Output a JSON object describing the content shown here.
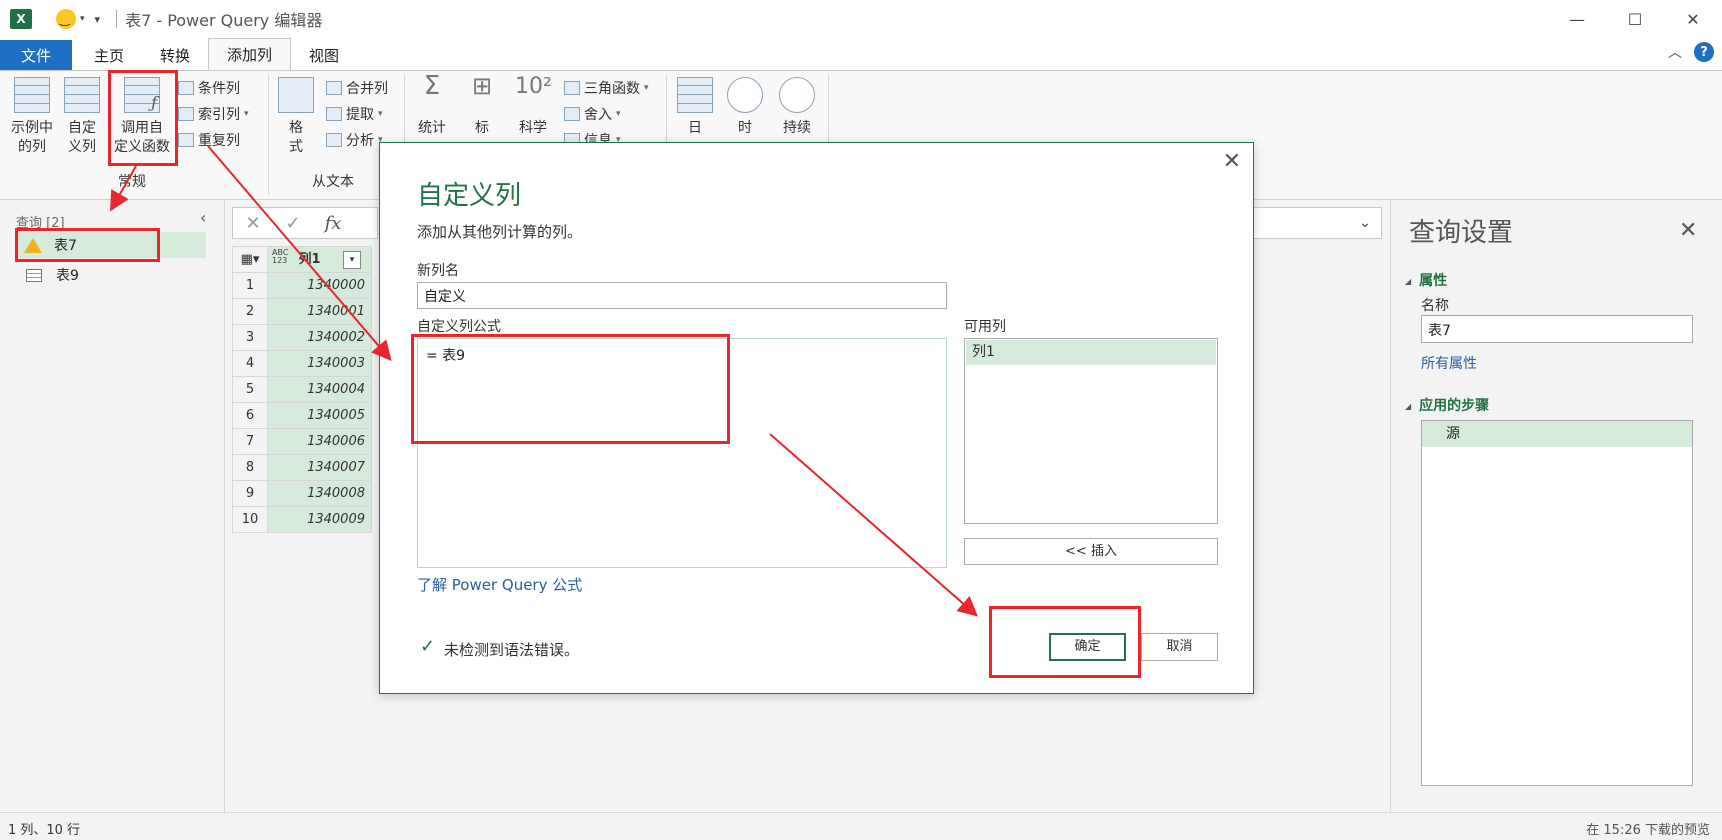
{
  "window": {
    "app_logo": "X",
    "title": "表7 - Power Query 编辑器",
    "controls": [
      "—",
      "☐",
      "✕"
    ]
  },
  "tabs": [
    {
      "label": "文件"
    },
    {
      "label": "主页"
    },
    {
      "label": "转换"
    },
    {
      "label": "添加列"
    },
    {
      "label": "视图"
    }
  ],
  "help_label": "?",
  "ribbon": {
    "example_col": "示例中\n的列",
    "custom_col": "自定\n义列",
    "invoke_fn": "调用自\n定义函数",
    "conditional_col": "条件列",
    "index_col": "索引列",
    "duplicate_col": "重复列",
    "group_general": "常规",
    "format": "格\n式",
    "merge_cols": "合并列",
    "extract": "提取",
    "parse": "分析",
    "group_from_text": "从文本",
    "statistics": "统计",
    "standard": "标",
    "scientific": "科学",
    "trig": "三角函数",
    "rounding": "舍入",
    "info": "信息",
    "date": "日",
    "time": "时",
    "duration": "持续"
  },
  "queries": {
    "header": "查询 [2]",
    "items": [
      "表7",
      "表9"
    ]
  },
  "formula_bar": {
    "cancel": "✕",
    "confirm": "✓",
    "fx": "fx",
    "expand": "⌄"
  },
  "grid": {
    "column_type": "ABC\n123",
    "column_name": "列1",
    "rows": [
      {
        "n": "1",
        "v": "1340000"
      },
      {
        "n": "2",
        "v": "1340001"
      },
      {
        "n": "3",
        "v": "1340002"
      },
      {
        "n": "4",
        "v": "1340003"
      },
      {
        "n": "5",
        "v": "1340004"
      },
      {
        "n": "6",
        "v": "1340005"
      },
      {
        "n": "7",
        "v": "1340006"
      },
      {
        "n": "8",
        "v": "1340007"
      },
      {
        "n": "9",
        "v": "1340008"
      },
      {
        "n": "10",
        "v": "1340009"
      }
    ]
  },
  "settings": {
    "title": "查询设置",
    "properties": "属性",
    "name_label": "名称",
    "name_value": "表7",
    "all_properties": "所有属性",
    "applied_steps": "应用的步骤",
    "steps": [
      "源"
    ]
  },
  "dialog": {
    "title": "自定义列",
    "subtitle": "添加从其他列计算的列。",
    "new_col_label": "新列名",
    "new_col_value": "自定义",
    "formula_label": "自定义列公式",
    "formula_value": "= 表9",
    "available_label": "可用列",
    "available": [
      "列1"
    ],
    "insert": "<< 插入",
    "learn_link": "了解 Power Query 公式",
    "status": "未检测到语法错误。",
    "ok": "确定",
    "cancel": "取消"
  },
  "status": {
    "left": "1 列、10 行",
    "right": "在 15:26 下载的预览"
  },
  "colors": {
    "accent": "#217346",
    "file_tab": "#1f6fc5",
    "selection": "#d5eadb",
    "annotation": "#e8262d"
  }
}
